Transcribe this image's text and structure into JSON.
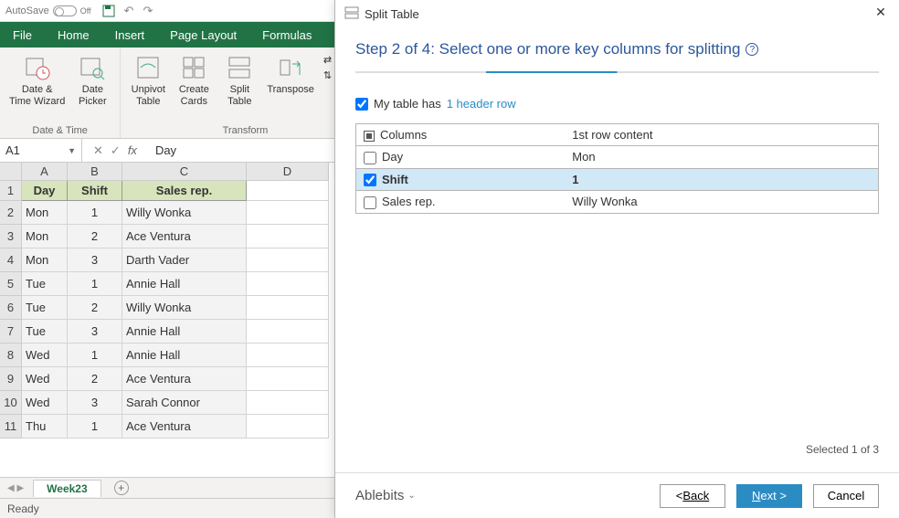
{
  "titlebar": {
    "autosave_label": "AutoSave",
    "autosave_state": "Off"
  },
  "ribbon_tabs": {
    "file": "File",
    "home": "Home",
    "insert": "Insert",
    "page_layout": "Page Layout",
    "formulas": "Formulas"
  },
  "ribbon": {
    "datetime": {
      "date_time_wizard": "Date &\nTime Wizard",
      "date_picker": "Date\nPicker",
      "group_label": "Date & Time"
    },
    "transform": {
      "unpivot_table": "Unpivot\nTable",
      "create_cards": "Create\nCards",
      "split_table": "Split\nTable",
      "transpose": "Transpose",
      "swap": "Swap",
      "flip": "Flip",
      "group_label": "Transform"
    }
  },
  "formula_bar": {
    "namebox": "A1",
    "content": "Day"
  },
  "sheet": {
    "columns": [
      "A",
      "B",
      "C",
      "D"
    ],
    "headers": [
      "Day",
      "Shift",
      "Sales rep."
    ],
    "rows": [
      {
        "n": 2,
        "day": "Mon",
        "shift": "1",
        "rep": "Willy Wonka"
      },
      {
        "n": 3,
        "day": "Mon",
        "shift": "2",
        "rep": "Ace Ventura"
      },
      {
        "n": 4,
        "day": "Mon",
        "shift": "3",
        "rep": "Darth Vader"
      },
      {
        "n": 5,
        "day": "Tue",
        "shift": "1",
        "rep": "Annie Hall"
      },
      {
        "n": 6,
        "day": "Tue",
        "shift": "2",
        "rep": "Willy Wonka"
      },
      {
        "n": 7,
        "day": "Tue",
        "shift": "3",
        "rep": "Annie Hall"
      },
      {
        "n": 8,
        "day": "Wed",
        "shift": "1",
        "rep": "Annie Hall"
      },
      {
        "n": 9,
        "day": "Wed",
        "shift": "2",
        "rep": "Ace Ventura"
      },
      {
        "n": 10,
        "day": "Wed",
        "shift": "3",
        "rep": "Sarah Connor"
      },
      {
        "n": 11,
        "day": "Thu",
        "shift": "1",
        "rep": "Ace Ventura"
      }
    ]
  },
  "sheet_tab": "Week23",
  "status": "Ready",
  "dialog": {
    "title": "Split Table",
    "step_title": "Step 2 of 4: Select one or more key columns for splitting",
    "check_prefix": "My table has ",
    "check_link": "1 header row",
    "col_header": "Columns",
    "content_header": "1st row content",
    "rows": [
      {
        "checked": false,
        "name": "Day",
        "content": "Mon"
      },
      {
        "checked": true,
        "name": "Shift",
        "content": "1"
      },
      {
        "checked": false,
        "name": "Sales rep.",
        "content": "Willy Wonka"
      }
    ],
    "selected_text": "Selected 1 of 3",
    "brand": "Ablebits",
    "back": "Back",
    "next": "Next >",
    "cancel": "Cancel"
  }
}
